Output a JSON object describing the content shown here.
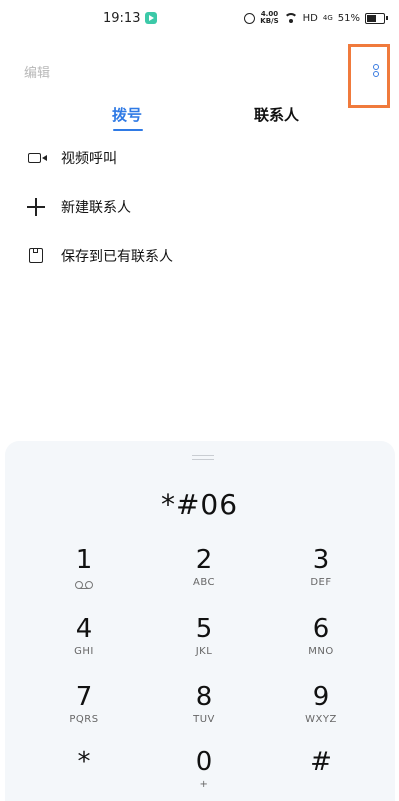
{
  "status_bar": {
    "time": "19:13",
    "speed_value": "4.00",
    "speed_unit": "KB/S",
    "hd": "HD",
    "network": "4G",
    "battery_percent": "51%",
    "battery_level": 0.51
  },
  "header": {
    "edit_label": "编辑",
    "menu_icon": "more-vertical-icon",
    "highlight_color": "#f07a3c"
  },
  "tabs": [
    {
      "label": "拨号",
      "active": true
    },
    {
      "label": "联系人",
      "active": false
    }
  ],
  "options": [
    {
      "icon": "video-call-icon",
      "label": "视频呼叫"
    },
    {
      "icon": "plus-icon",
      "label": "新建联系人"
    },
    {
      "icon": "save-icon",
      "label": "保存到已有联系人"
    }
  ],
  "dialpad": {
    "entered_number": "*#06",
    "keys": [
      {
        "digit": "1",
        "sub": ""
      },
      {
        "digit": "2",
        "sub": "ABC"
      },
      {
        "digit": "3",
        "sub": "DEF"
      },
      {
        "digit": "4",
        "sub": "GHI"
      },
      {
        "digit": "5",
        "sub": "JKL"
      },
      {
        "digit": "6",
        "sub": "MNO"
      },
      {
        "digit": "7",
        "sub": "PQRS"
      },
      {
        "digit": "8",
        "sub": "TUV"
      },
      {
        "digit": "9",
        "sub": "WXYZ"
      },
      {
        "digit": "*",
        "sub": ""
      },
      {
        "digit": "0",
        "sub": "+"
      },
      {
        "digit": "#",
        "sub": ""
      }
    ]
  },
  "colors": {
    "accent": "#2f7ae5",
    "pad_background": "#f4f7fa"
  }
}
